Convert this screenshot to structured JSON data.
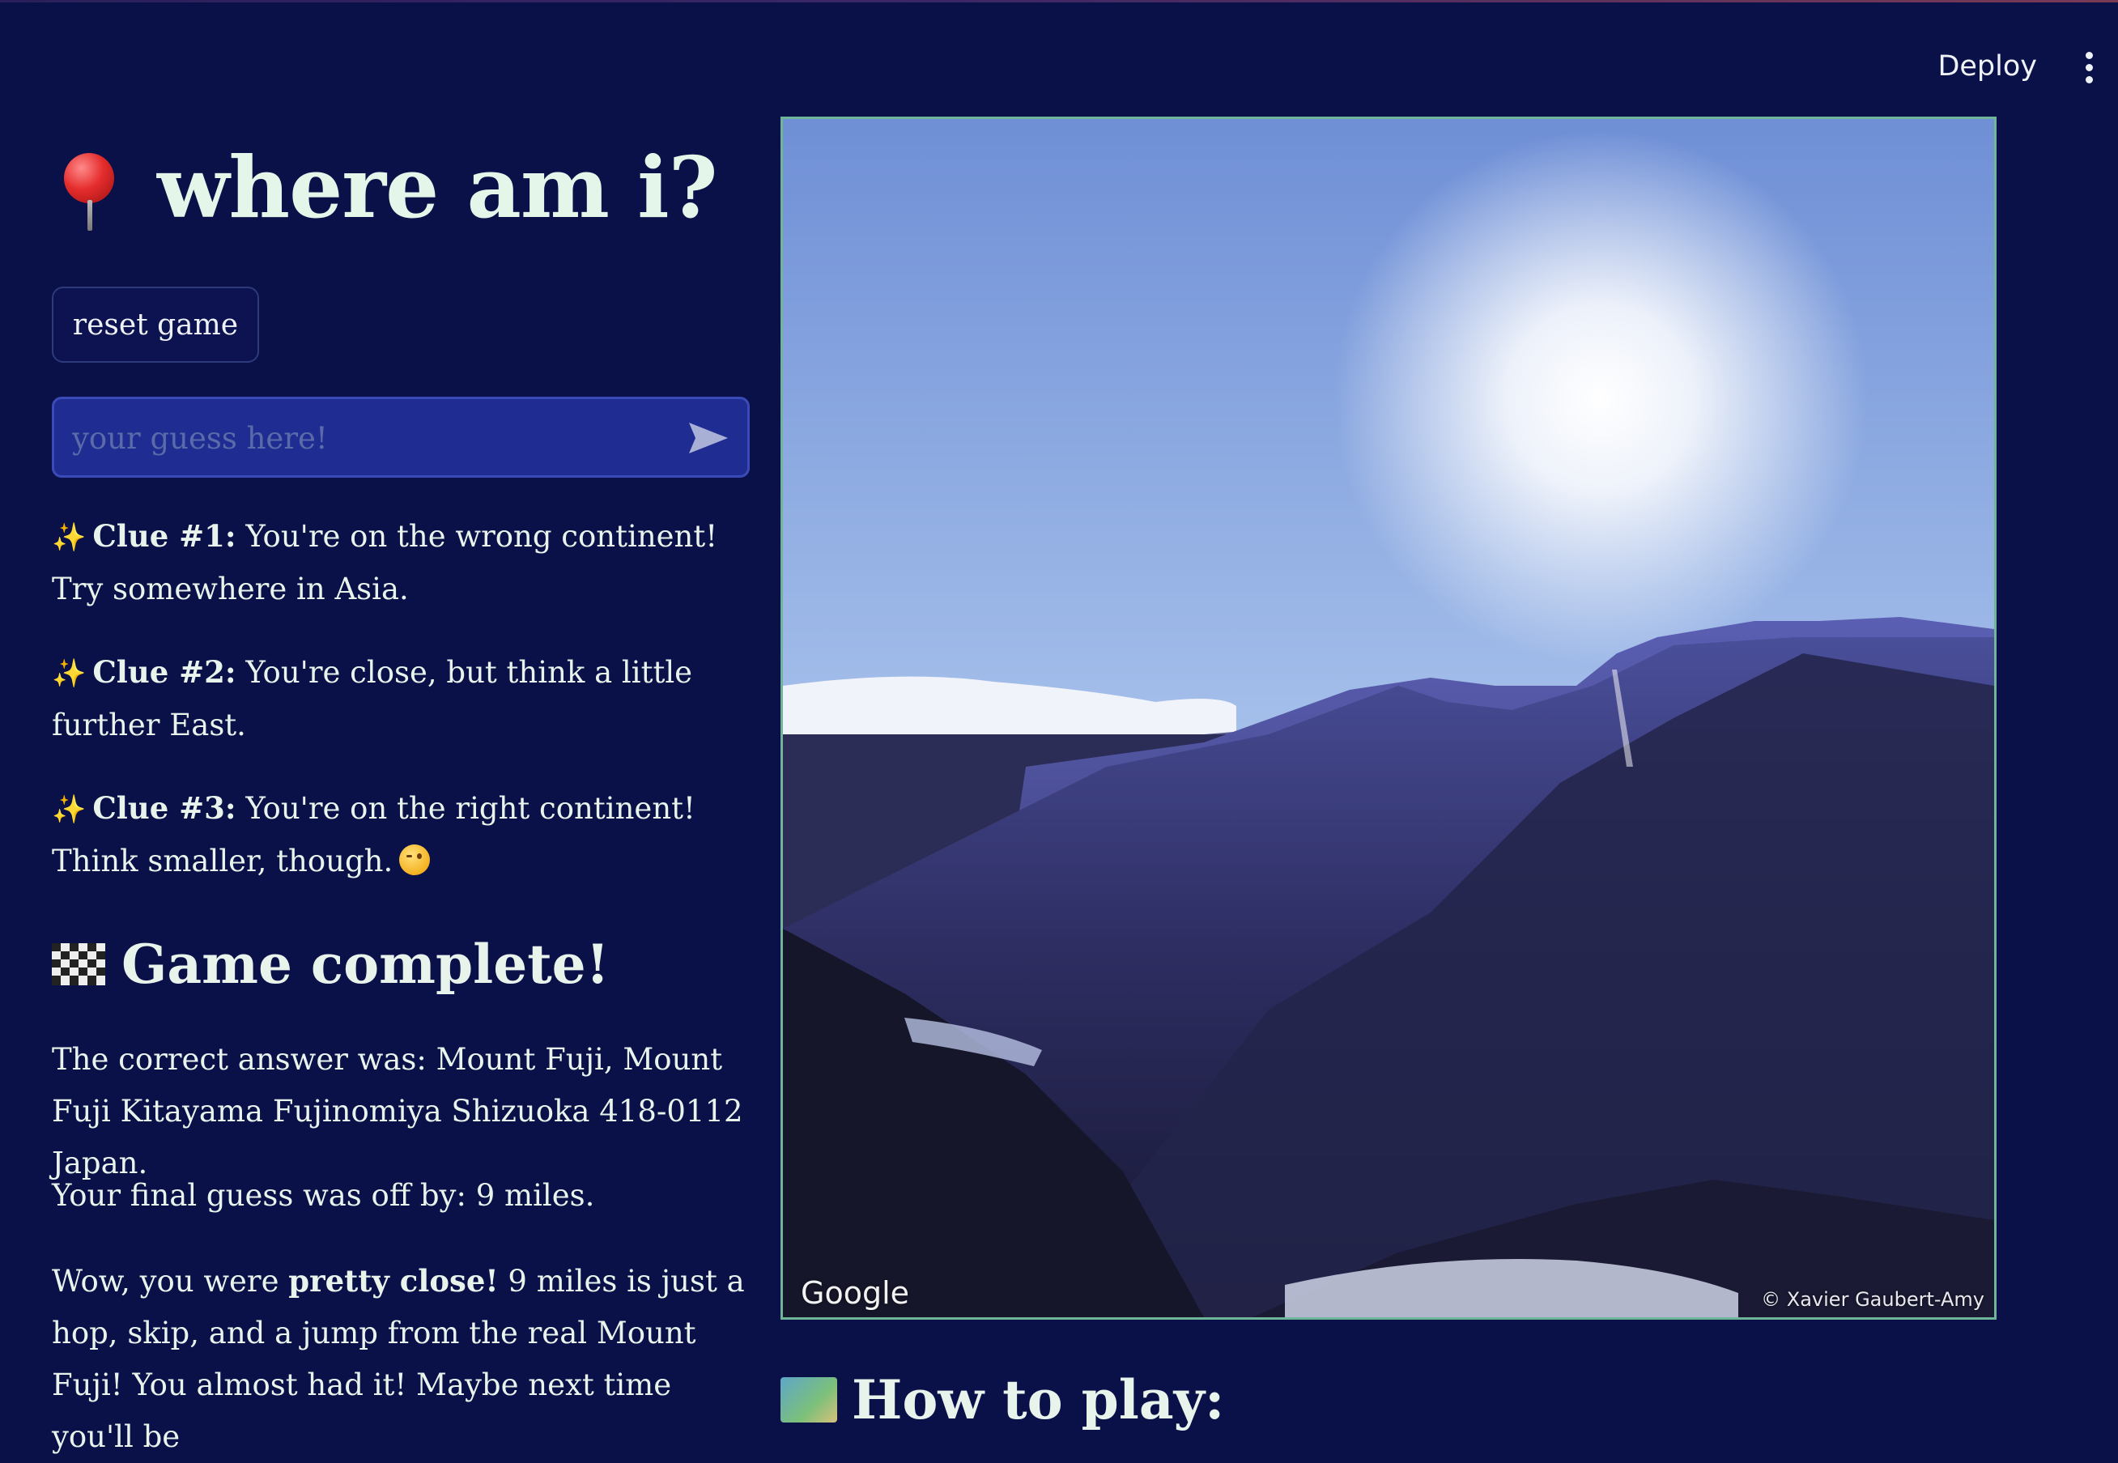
{
  "header": {
    "deploy_label": "Deploy"
  },
  "app": {
    "title": "where am i?",
    "reset_label": "reset game",
    "guess_placeholder": "your guess here!"
  },
  "clues": [
    {
      "label": "Clue #1:",
      "text": " You're on the wrong continent! Try somewhere in Asia."
    },
    {
      "label": "Clue #2:",
      "text": " You're close, but think a little further East."
    },
    {
      "label": "Clue #3:",
      "text": " You're on the right continent! Think smaller, though."
    }
  ],
  "result": {
    "heading": "Game complete!",
    "answer_text": "The correct answer was: Mount Fuji, Mount Fuji Kitayama Fujinomiya Shizuoka 418-0112 Japan.",
    "guess_text": "Your final guess was off by: 9 miles.",
    "feedback_prefix": "Wow, you were ",
    "feedback_bold": "pretty close!",
    "feedback_suffix": " 9 miles is just a hop, skip, and a jump from the real Mount Fuji! You almost had it! Maybe next time you'll be"
  },
  "photo": {
    "provider_mark": "Google",
    "attribution": "© Xavier Gaubert-Amy"
  },
  "howto": {
    "heading": "How to play:"
  }
}
